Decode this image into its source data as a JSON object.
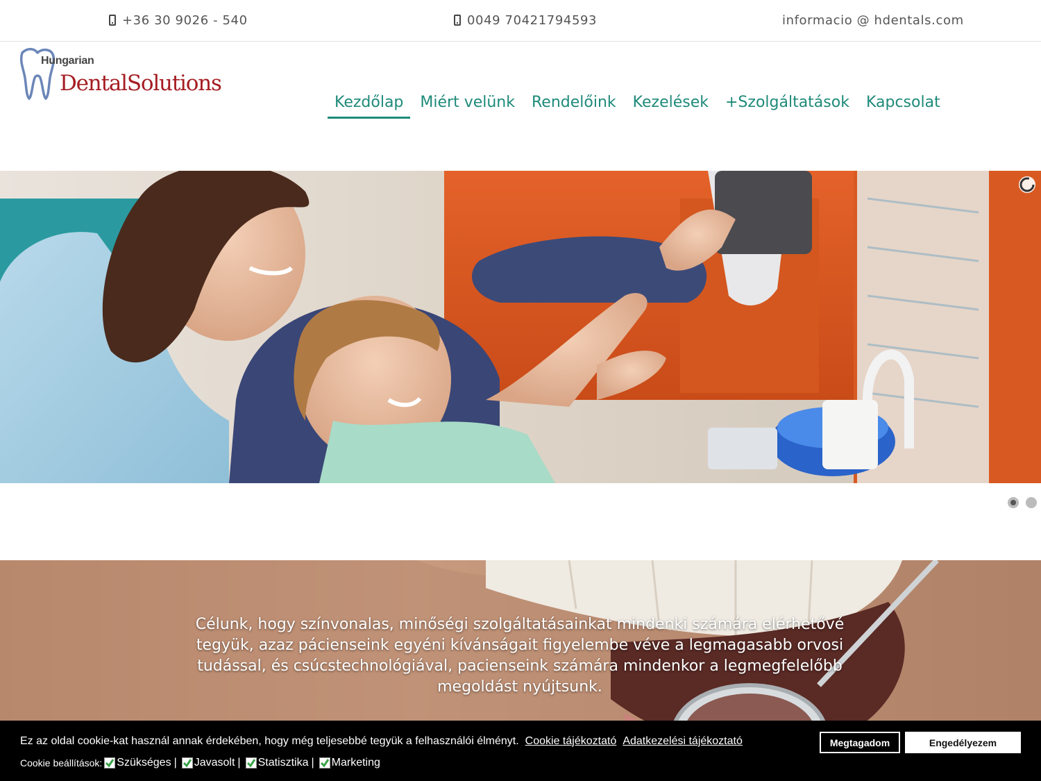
{
  "topbar": {
    "phone_hu": "+36 30 9026 - 540",
    "phone_de": "0049 70421794593",
    "email": "informacio @ hdentals.com"
  },
  "logo": {
    "line1": "Hungarian",
    "line2": "DentalSolutions"
  },
  "nav": {
    "items": [
      {
        "label": "Kezdőlap",
        "active": true
      },
      {
        "label": "Miért velünk"
      },
      {
        "label": "Rendelőink"
      },
      {
        "label": "Kezelések"
      },
      {
        "label": "+Szolgáltatások"
      },
      {
        "label": "Kapcsolat"
      }
    ]
  },
  "slider": {
    "slide_count": 2,
    "active_slide": 1
  },
  "mission": {
    "text": "Célunk, hogy színvonalas, minőségi szolgáltatásainkat mindenki számára elérhetővé tegyük, azaz pácienseink egyéni kívánságait figyelembe véve a legmagasabb orvosi tudással, és csúcstechnológiával, pacienseink számára mindenkor a legmegfelelőbb megoldást nyújtsunk."
  },
  "cookie": {
    "message": "Ez az oldal cookie-kat használ annak érdekében, hogy még teljesebbé tegyük a felhasználói élményt.",
    "link_cookie": "Cookie tájékoztató",
    "link_privacy": "Adatkezelési tájékoztató",
    "settings_label": "Cookie beállítások:",
    "options": [
      {
        "label": "Szükséges",
        "checked": true
      },
      {
        "label": "Javasolt",
        "checked": true
      },
      {
        "label": "Statisztika",
        "checked": true
      },
      {
        "label": "Marketing",
        "checked": true
      }
    ],
    "deny_label": "Megtagadom",
    "allow_label": "Engedélyezem"
  },
  "colors": {
    "brand_red": "#a51d23",
    "nav_teal": "#1e8a7a",
    "check_green": "#3aa34a"
  }
}
